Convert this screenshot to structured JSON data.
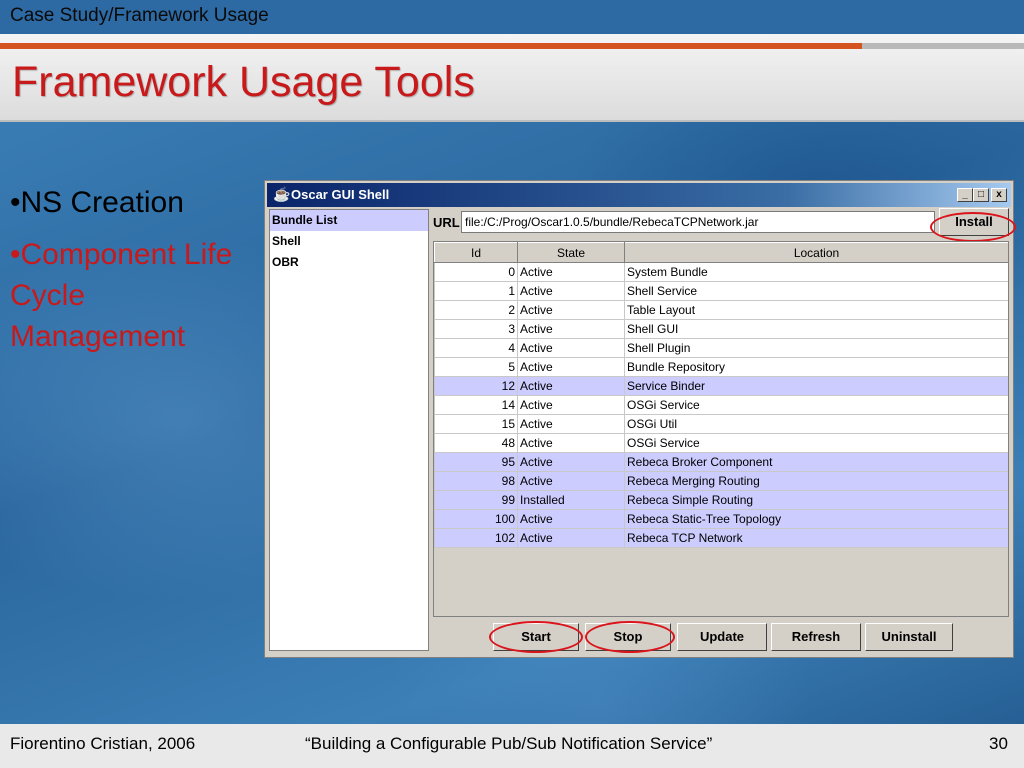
{
  "slide": {
    "section": "Case Study/Framework Usage",
    "title": "Framework Usage Tools",
    "bullets": [
      {
        "text": "•NS Creation",
        "color": "#000000"
      },
      {
        "text": "•Component Life Cycle Management",
        "color": "#c8191b"
      }
    ],
    "footer": {
      "author": "Fiorentino Cristian, 2006",
      "talk": "“Building a Configurable Pub/Sub Notification Service”",
      "page": "30"
    }
  },
  "window": {
    "title": "Oscar GUI Shell",
    "icon": "java-cup-icon",
    "controls": {
      "minimize": "_",
      "maximize": "□",
      "close": "x"
    },
    "left_list": [
      {
        "label": "Bundle List",
        "selected": true
      },
      {
        "label": "Shell",
        "selected": false
      },
      {
        "label": "OBR",
        "selected": false
      }
    ],
    "url_label": "URL",
    "url_value": "file:/C:/Prog/Oscar1.0.5/bundle/RebecaTCPNetwork.jar",
    "install_label": "Install",
    "table": {
      "columns": [
        "Id",
        "State",
        "Location"
      ],
      "rows": [
        {
          "id": "0",
          "state": "Active",
          "location": "System Bundle",
          "highlight": false
        },
        {
          "id": "1",
          "state": "Active",
          "location": "Shell Service",
          "highlight": false
        },
        {
          "id": "2",
          "state": "Active",
          "location": "Table Layout",
          "highlight": false
        },
        {
          "id": "3",
          "state": "Active",
          "location": "Shell GUI",
          "highlight": false
        },
        {
          "id": "4",
          "state": "Active",
          "location": "Shell Plugin",
          "highlight": false
        },
        {
          "id": "5",
          "state": "Active",
          "location": "Bundle Repository",
          "highlight": false
        },
        {
          "id": "12",
          "state": "Active",
          "location": "Service Binder",
          "highlight": true
        },
        {
          "id": "14",
          "state": "Active",
          "location": "OSGi Service",
          "highlight": false
        },
        {
          "id": "15",
          "state": "Active",
          "location": "OSGi Util",
          "highlight": false
        },
        {
          "id": "48",
          "state": "Active",
          "location": "OSGi Service",
          "highlight": false
        },
        {
          "id": "95",
          "state": "Active",
          "location": "Rebeca Broker Component",
          "highlight": true
        },
        {
          "id": "98",
          "state": "Active",
          "location": "Rebeca Merging Routing",
          "highlight": true
        },
        {
          "id": "99",
          "state": "Installed",
          "location": "Rebeca Simple Routing",
          "highlight": true
        },
        {
          "id": "100",
          "state": "Active",
          "location": "Rebeca Static-Tree Topology",
          "highlight": true
        },
        {
          "id": "102",
          "state": "Active",
          "location": "Rebeca TCP Network",
          "highlight": true
        }
      ]
    },
    "buttons": {
      "start": "Start",
      "stop": "Stop",
      "update": "Update",
      "refresh": "Refresh",
      "uninstall": "Uninstall"
    }
  },
  "colors": {
    "title_red": "#c8191b",
    "highlight_row": "#ccccff",
    "annotation_circle": "#d9151b"
  }
}
